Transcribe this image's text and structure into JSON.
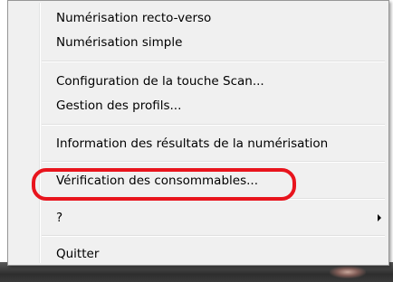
{
  "menu": {
    "items": [
      {
        "label": "Numérisation recto-verso"
      },
      {
        "label": "Numérisation simple"
      },
      {
        "label": "Configuration de la touche Scan..."
      },
      {
        "label": "Gestion des profils..."
      },
      {
        "label": "Information des résultats de la numérisation"
      },
      {
        "label": "Vérification des consommables..."
      },
      {
        "label": "?",
        "has_submenu": true
      },
      {
        "label": "Quitter"
      }
    ],
    "highlighted_item": "Vérification des consommables...",
    "highlight_color": "#e8141d"
  }
}
